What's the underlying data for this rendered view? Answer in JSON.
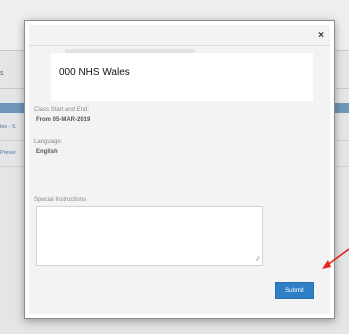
{
  "background": {
    "tab_fragment": "s",
    "side_link_1": "ies - S",
    "side_link_2": "Prevei"
  },
  "modal": {
    "close_label": "×",
    "organisation": "000 NHS Wales",
    "class_start_end_label": "Class Start and End:",
    "class_start_end_value": "From 05-MAR-2019",
    "language_label": "Language:",
    "language_value": "English",
    "special_instructions_label": "Special Instructions",
    "special_instructions_value": "",
    "submit_label": "Submit"
  },
  "annotation": {
    "arrow_color": "#e8231c"
  }
}
